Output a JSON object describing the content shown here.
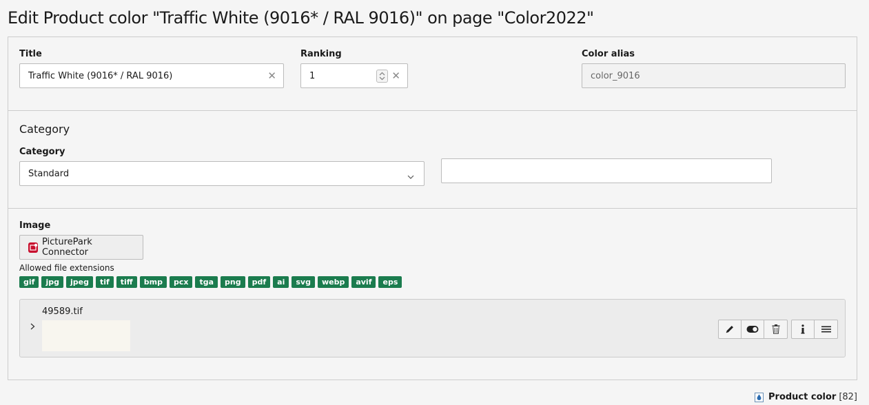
{
  "page": {
    "title": "Edit Product color \"Traffic White (9016* / RAL 9016)\" on page \"Color2022\""
  },
  "fields": {
    "title_label": "Title",
    "title_value": "Traffic White (9016* / RAL 9016)",
    "ranking_label": "Ranking",
    "ranking_value": "1",
    "color_alias_label": "Color alias",
    "color_alias_value": "color_9016"
  },
  "category_section": {
    "heading": "Category",
    "label": "Category",
    "selected": "Standard",
    "extra_value": ""
  },
  "image_section": {
    "label": "Image",
    "connector_button": "PicturePark Connector",
    "allowed_label": "Allowed file extensions",
    "extensions": [
      "gif",
      "jpg",
      "jpeg",
      "tif",
      "tiff",
      "bmp",
      "pcx",
      "tga",
      "png",
      "pdf",
      "ai",
      "svg",
      "webp",
      "avif",
      "eps"
    ],
    "file": {
      "name": "49589.tif",
      "toggle_icon": "chevron-right-icon"
    },
    "actions": [
      "pencil-icon",
      "toggle-icon",
      "trash-icon",
      "info-icon",
      "menu-icon"
    ]
  },
  "footer": {
    "record_label": "Product color",
    "record_id": "[82]"
  },
  "colors": {
    "extension_badge": "#1b7c4e",
    "connector_icon": "#c8102e"
  }
}
